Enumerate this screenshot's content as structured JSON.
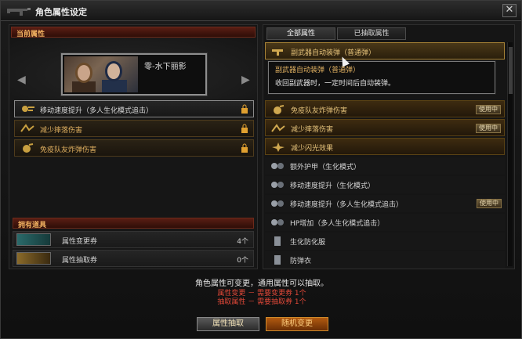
{
  "window": {
    "title": "角色属性设定",
    "close_label": "✕"
  },
  "left": {
    "section_title": "当前属性",
    "character_name": "零-水下丽影",
    "attributes": [
      {
        "label": "移动速度提升（多人生化模式追击）"
      },
      {
        "label": "减少摔落伤害"
      },
      {
        "label": "免疫队友炸弹伤害"
      }
    ],
    "items_title": "拥有道具",
    "items": [
      {
        "label": "属性变更券",
        "count": "4个"
      },
      {
        "label": "属性抽取券",
        "count": "0个"
      }
    ]
  },
  "right": {
    "tabs": [
      {
        "label": "全部属性"
      },
      {
        "label": "已抽取属性"
      }
    ],
    "rows": [
      {
        "label": "副武器自动装弹（普通弹）",
        "status": "selected"
      },
      {
        "label": "免疫队友炸弹伤害",
        "status": "owned",
        "badge": "使用中"
      },
      {
        "label": "减少摔落伤害",
        "status": "owned",
        "badge": "使用中"
      },
      {
        "label": "减少闪光效果",
        "status": "owned"
      },
      {
        "label": "额外护甲（生化模式）",
        "status": "plain"
      },
      {
        "label": "移动速度提升（生化模式）",
        "status": "plain"
      },
      {
        "label": "移动速度提升（多人生化模式追击）",
        "status": "plain",
        "badge": "使用中"
      },
      {
        "label": "HP增加（多人生化模式追击）",
        "status": "plain"
      },
      {
        "label": "生化防化服",
        "status": "plain"
      },
      {
        "label": "防弹衣",
        "status": "plain"
      }
    ],
    "tooltip": {
      "title": "副武器自动装弹（普通弹）",
      "body": "收回副武器时，一定时间后自动装弹。"
    }
  },
  "bottom": {
    "message": "角色属性可变更，通用属性可以抽取。",
    "change_rule": "属性变更 － 需要变更券 1个",
    "extract_rule": "抽取属性 － 需要抽取券 1个",
    "extract_button": "属性抽取",
    "random_button": "随机变更"
  },
  "colors": {
    "accent_gold": "#e0b060",
    "warning_red": "#e04838",
    "orange_button": "#b25a10"
  }
}
